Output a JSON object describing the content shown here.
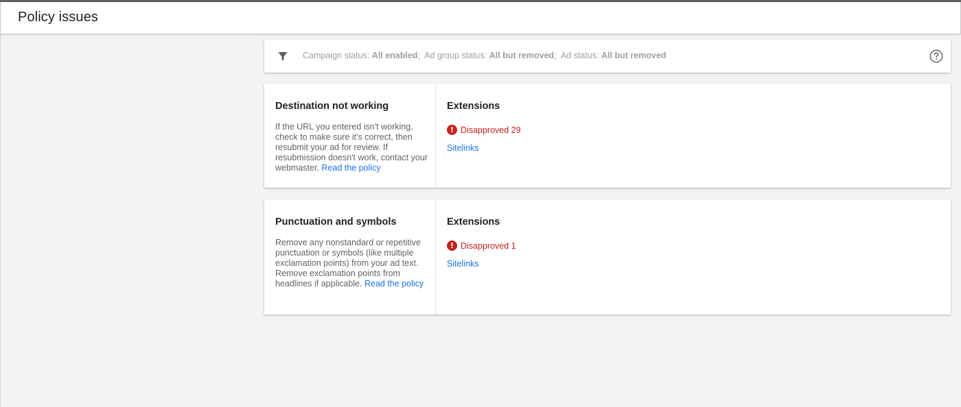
{
  "header": {
    "title": "Policy issues"
  },
  "filter": {
    "segments": [
      {
        "label": "Campaign status:",
        "value": "All enabled"
      },
      {
        "label": "Ad group status:",
        "value": "All but removed"
      },
      {
        "label": "Ad status:",
        "value": "All but removed"
      }
    ],
    "separator": ";",
    "filter_icon": "filter-icon",
    "help_icon": "help-circle-icon"
  },
  "issues": [
    {
      "title": "Destination not working",
      "description": "If the URL you entered isn't working, check to make sure it's correct, then resubmit your ad for review. If resubmission doesn't work, contact your webmaster.",
      "policy_link": "Read the policy",
      "category": "Extensions",
      "status_icon": "error-icon",
      "status": "Disapproved 29",
      "type_link": "Sitelinks"
    },
    {
      "title": "Punctuation and symbols",
      "description": "Remove any nonstandard or repetitive punctuation or symbols (like multiple exclamation points) from your ad text. Remove exclamation points from headlines if applicable.",
      "policy_link": "Read the policy",
      "category": "Extensions",
      "status_icon": "error-icon",
      "status": "Disapproved 1",
      "type_link": "Sitelinks"
    }
  ],
  "colors": {
    "background": "#f1f3f4",
    "error": "#c5221f",
    "link": "#1a73e8",
    "muted_text": "#9aa0a6"
  }
}
